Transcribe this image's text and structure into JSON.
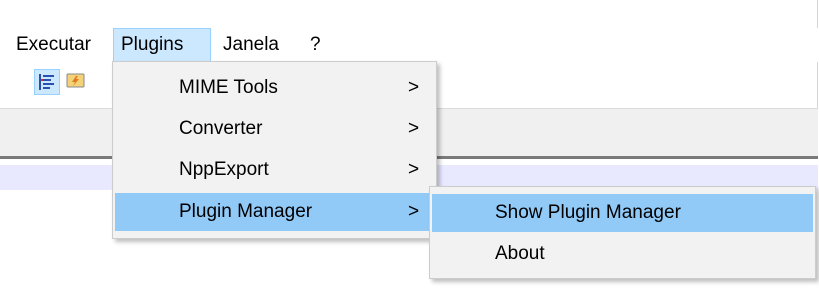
{
  "menubar": {
    "items": [
      {
        "label": "Executar"
      },
      {
        "label": "Plugins"
      },
      {
        "label": "Janela"
      },
      {
        "label": "?"
      }
    ],
    "active": "Plugins"
  },
  "toolbar": {
    "buttons": [
      {
        "icon": "indent-guide-icon",
        "selected": true
      },
      {
        "icon": "macro-icon",
        "selected": false
      }
    ]
  },
  "plugins_menu": {
    "items": [
      {
        "label": "MIME Tools",
        "chevron": ">"
      },
      {
        "label": "Converter",
        "chevron": ">"
      },
      {
        "label": "NppExport",
        "chevron": ">"
      },
      {
        "label": "Plugin Manager",
        "chevron": ">",
        "highlighted": true
      }
    ]
  },
  "plugin_manager_submenu": {
    "items": [
      {
        "label": "Show Plugin Manager",
        "highlighted": true
      },
      {
        "label": "About"
      }
    ]
  },
  "colors": {
    "menu_highlight": "#91c9f7",
    "menubar_active": "#cce8ff",
    "menu_background": "#f2f2f2",
    "current_line": "#e8e8ff"
  }
}
